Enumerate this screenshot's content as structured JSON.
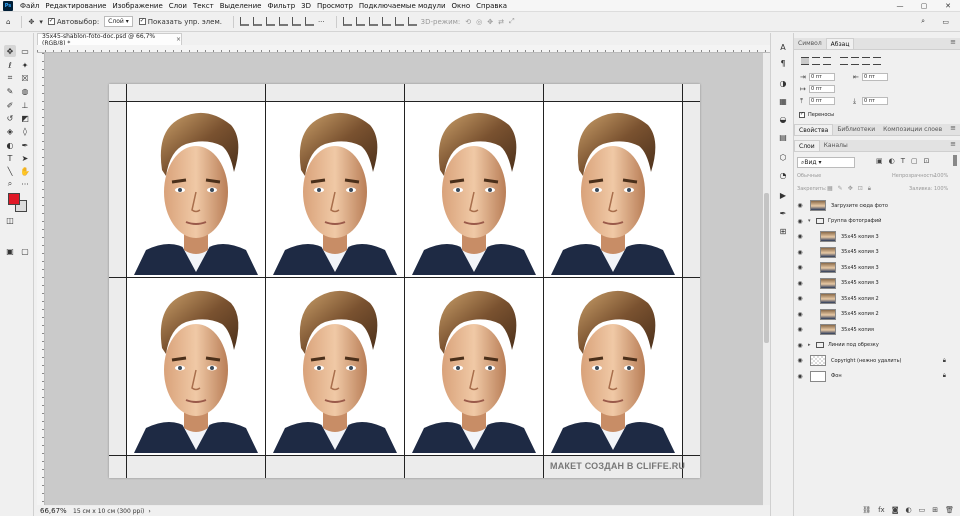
{
  "menu": {
    "app_logo": "Ps",
    "items": [
      "Файл",
      "Редактирование",
      "Изображение",
      "Слои",
      "Текст",
      "Выделение",
      "Фильтр",
      "3D",
      "Просмотр",
      "Подключаемые модули",
      "Окно",
      "Справка"
    ],
    "window_controls": [
      "—",
      "▢",
      "✕"
    ]
  },
  "options": {
    "autoselect_label": "Автовыбор:",
    "autoselect_target": "Слой",
    "show_transform_label": "Показать упр. элем.",
    "mode_3d_label": "3D-режим:"
  },
  "document": {
    "tab_title": "35x45-shablon-foto-doc.psd @ 66,7% (RGB/8) *",
    "close_glyph": "×",
    "watermark": "МАКЕТ СОЗДАН В CLIFFE.RU",
    "grid_rows": 2,
    "grid_cols": 4
  },
  "status": {
    "zoom": "66,67%",
    "doc_info": "15 см x 10 см (300 ppi)"
  },
  "panels": {
    "top_tabs": [
      "Символ",
      "Абзац"
    ],
    "top_active": "Абзац",
    "para_fields": [
      "0 пт",
      "0 пт",
      "0 пт",
      "0 пт",
      "0 пт"
    ],
    "hyphenate_label": "Переносы",
    "mid_tabs": [
      "Свойства",
      "Библиотеки",
      "Композиции слоев"
    ],
    "layer_tabs": [
      "Слои",
      "Каналы"
    ],
    "kind_filter": "Вид",
    "blend_mode": "Обычные",
    "opacity_label": "Непрозрачность:",
    "opacity_value": "100%",
    "lock_label": "Закрепить:",
    "fill_label": "Заливка:",
    "fill_value": "100%"
  },
  "layers": [
    {
      "name": "Загрузите сюда фото",
      "type": "smart",
      "indent": 0,
      "selected": false,
      "locked": false
    },
    {
      "name": "Группа фотографий",
      "type": "group-open",
      "indent": 0,
      "selected": false,
      "locked": false
    },
    {
      "name": "35x45 копия 3",
      "type": "smart",
      "indent": 1,
      "selected": false,
      "locked": false
    },
    {
      "name": "35x45 копия 3",
      "type": "smart",
      "indent": 1,
      "selected": false,
      "locked": false
    },
    {
      "name": "35x45 копия 3",
      "type": "smart",
      "indent": 1,
      "selected": false,
      "locked": false
    },
    {
      "name": "35x45 копия 3",
      "type": "smart",
      "indent": 1,
      "selected": false,
      "locked": false
    },
    {
      "name": "35x45 копия 2",
      "type": "smart",
      "indent": 1,
      "selected": false,
      "locked": false
    },
    {
      "name": "35x45 копия 2",
      "type": "smart",
      "indent": 1,
      "selected": false,
      "locked": false
    },
    {
      "name": "35x45 копия",
      "type": "smart",
      "indent": 1,
      "selected": false,
      "locked": false
    },
    {
      "name": "Линии под обрезку",
      "type": "group-closed",
      "indent": 0,
      "selected": false,
      "locked": false
    },
    {
      "name": "Copyright (нежно удалить)",
      "type": "check",
      "indent": 0,
      "selected": false,
      "locked": true
    },
    {
      "name": "Фон",
      "type": "white",
      "indent": 0,
      "selected": false,
      "locked": true
    }
  ],
  "colors": {
    "foreground": "#e01826",
    "background": "#dcdcdc",
    "canvas_bg": "#cacaca",
    "ps_logo_bg": "#001e36"
  }
}
